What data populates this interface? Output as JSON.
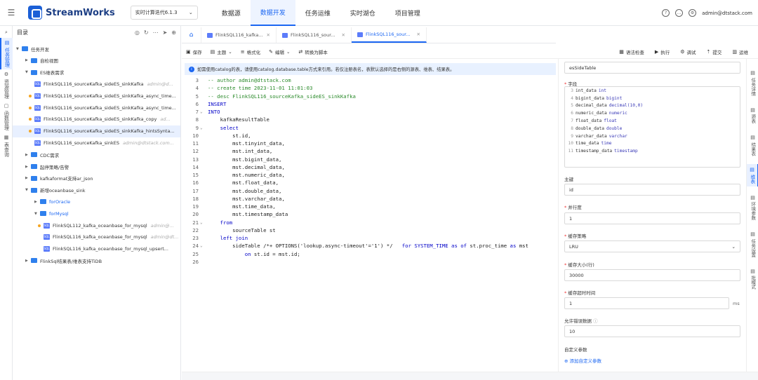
{
  "header": {
    "app_name": "StreamWorks",
    "version_select": "实时计算迭代6.1.3",
    "nav": [
      {
        "label": "数据源",
        "active": false
      },
      {
        "label": "数据开发",
        "active": true
      },
      {
        "label": "任务运维",
        "active": false
      },
      {
        "label": "实时湖仓",
        "active": false
      },
      {
        "label": "项目管理",
        "active": false
      }
    ],
    "user": "admin@dtstack.com"
  },
  "left_rail": [
    {
      "label": "任务管理",
      "active": true
    },
    {
      "label": "资源管理",
      "active": false
    },
    {
      "label": "函数管理",
      "active": false
    },
    {
      "label": "表查询",
      "active": false
    }
  ],
  "tree": {
    "title": "目录",
    "rows": [
      {
        "label": "任务开发",
        "type": "folder",
        "level": 0,
        "expanded": true
      },
      {
        "label": "自检视图",
        "type": "folder",
        "level": 1,
        "expanded": false
      },
      {
        "label": "ES维表需求",
        "type": "folder",
        "level": 1,
        "expanded": true
      },
      {
        "label": "FlinkSQL116_sourceKafka_sideES_sinkKafka",
        "type": "sql",
        "level": 2,
        "owner": "admin@d...",
        "dot": false
      },
      {
        "label": "FlinkSQL116_sourceKafka_sideES_sinkKafka_async_time...",
        "type": "sql",
        "level": 2,
        "owner": "",
        "dot": true
      },
      {
        "label": "FlinkSQL116_sourceKafka_sideES_sinkKafka_async_time...",
        "type": "sql",
        "level": 2,
        "owner": "",
        "dot": true
      },
      {
        "label": "FlinkSQL116_sourceKafka_sideES_sinkKafka_copy",
        "type": "sql",
        "level": 2,
        "owner": "ad...",
        "dot": true
      },
      {
        "label": "FlinkSQL116_sourceKafka_sideES_sinkKafka_hintsSynta...",
        "type": "sql",
        "level": 2,
        "owner": "",
        "dot": true,
        "selected": true
      },
      {
        "label": "FlinkSQL116_sourceKafka_sinkES",
        "type": "sql",
        "level": 2,
        "owner": "admin@dtstack.com...",
        "dot": false
      },
      {
        "label": "CDC需求",
        "type": "folder",
        "level": 1,
        "expanded": false
      },
      {
        "label": "起停策略/告警",
        "type": "folder",
        "level": 1,
        "expanded": false
      },
      {
        "label": "kafkaformat支持ar_json",
        "type": "folder",
        "level": 1,
        "expanded": false
      },
      {
        "label": "新增oceanbase_sink",
        "type": "folder",
        "level": 1,
        "expanded": true
      },
      {
        "label": "forOracle",
        "type": "folder",
        "level": 2,
        "expanded": false
      },
      {
        "label": "forMysql",
        "type": "folder",
        "level": 2,
        "expanded": true
      },
      {
        "label": "FlinkSQL112_kafka_oceanbase_for_mysql",
        "type": "sql",
        "level": 3,
        "owner": "admin@...",
        "dot": true
      },
      {
        "label": "FlinkSQL116_kafka_oceanbase_for_mysql",
        "type": "sql",
        "level": 3,
        "owner": "admin@dt...",
        "dot": false
      },
      {
        "label": "FlinkSQL116_kafka_oceanbase_for_mysql_upsert...",
        "type": "sql",
        "level": 3,
        "owner": "",
        "dot": false
      },
      {
        "label": "FlinkSql结果表/维表支持TiDB",
        "type": "folder",
        "level": 1,
        "expanded": false
      }
    ]
  },
  "tabs": [
    {
      "label": "FlinkSQL116_kafka...",
      "active": false
    },
    {
      "label": "FlinkSQL116_sour...",
      "active": false
    },
    {
      "label": "FlinkSQL116_sour...",
      "active": true
    }
  ],
  "toolbar": {
    "left": [
      "保存",
      "主题",
      "格式化",
      "编辑",
      "转换为脚本"
    ],
    "right": [
      "语法检查",
      "执行",
      "调试",
      "提交",
      "运维"
    ]
  },
  "banner": "如需使用catalog的表，请使用catalog.database.table方式来引用。若仅注册表名，表默认选择的是右侧的源表、维表、结果表。",
  "code_lines": [
    {
      "n": "3",
      "fold": "",
      "segs": [
        {
          "t": "-- author admin@dtstack.com",
          "c": "cm"
        }
      ]
    },
    {
      "n": "4",
      "fold": "",
      "segs": [
        {
          "t": "-- create time 2023-11-01 11:01:03",
          "c": "cm"
        }
      ]
    },
    {
      "n": "5",
      "fold": "",
      "segs": [
        {
          "t": "-- desc FlinkSQL116_sourceKafka_sideES_sinkKafka",
          "c": "cm"
        }
      ]
    },
    {
      "n": "6",
      "fold": "",
      "segs": [
        {
          "t": "INSERT",
          "c": "kw"
        }
      ]
    },
    {
      "n": "7",
      "fold": "v",
      "segs": [
        {
          "t": "INTO",
          "c": "kw"
        }
      ]
    },
    {
      "n": "8",
      "fold": "",
      "segs": [
        {
          "t": "    kafkaResultTable",
          "c": "tx"
        }
      ]
    },
    {
      "n": "9",
      "fold": "v",
      "segs": [
        {
          "t": "    select",
          "c": "kw"
        }
      ]
    },
    {
      "n": "10",
      "fold": "",
      "segs": [
        {
          "t": "        st.id,",
          "c": "tx"
        }
      ]
    },
    {
      "n": "11",
      "fold": "",
      "segs": [
        {
          "t": "        mst.tinyint_data,",
          "c": "tx"
        }
      ]
    },
    {
      "n": "12",
      "fold": "",
      "segs": [
        {
          "t": "        mst.int_data,",
          "c": "tx"
        }
      ]
    },
    {
      "n": "13",
      "fold": "",
      "segs": [
        {
          "t": "        mst.bigint_data,",
          "c": "tx"
        }
      ]
    },
    {
      "n": "14",
      "fold": "",
      "segs": [
        {
          "t": "        mst.decimal_data,",
          "c": "tx"
        }
      ]
    },
    {
      "n": "15",
      "fold": "",
      "segs": [
        {
          "t": "        mst.numeric_data,",
          "c": "tx"
        }
      ]
    },
    {
      "n": "16",
      "fold": "",
      "segs": [
        {
          "t": "        mst.float_data,",
          "c": "tx"
        }
      ]
    },
    {
      "n": "17",
      "fold": "",
      "segs": [
        {
          "t": "        mst.double_data,",
          "c": "tx"
        }
      ]
    },
    {
      "n": "18",
      "fold": "",
      "segs": [
        {
          "t": "        mst.varchar_data,",
          "c": "tx"
        }
      ]
    },
    {
      "n": "19",
      "fold": "",
      "segs": [
        {
          "t": "        mst.time_data,",
          "c": "tx"
        }
      ]
    },
    {
      "n": "20",
      "fold": "",
      "segs": [
        {
          "t": "        mst.timestamp_data",
          "c": "tx"
        }
      ]
    },
    {
      "n": "21",
      "fold": "v",
      "segs": [
        {
          "t": "    from",
          "c": "kw"
        }
      ]
    },
    {
      "n": "22",
      "fold": "",
      "segs": [
        {
          "t": "        sourceTable st",
          "c": "tx"
        }
      ]
    },
    {
      "n": "23",
      "fold": "",
      "segs": [
        {
          "t": "    left join",
          "c": "kw"
        }
      ]
    },
    {
      "n": "24",
      "fold": "v",
      "segs": [
        {
          "t": "        sideTable /*+ OPTIONS('lookup.async-timeout'='1') */   ",
          "c": "tx"
        },
        {
          "t": "for SYSTEM_TIME as of ",
          "c": "kw"
        },
        {
          "t": "st.proc_time ",
          "c": "tx"
        },
        {
          "t": "as ",
          "c": "kw"
        },
        {
          "t": "mst",
          "c": "tx"
        }
      ]
    },
    {
      "n": "25",
      "fold": "",
      "segs": [
        {
          "t": "            ",
          "c": "tx"
        },
        {
          "t": "on ",
          "c": "kw"
        },
        {
          "t": "st.id = mst.id;",
          "c": "tx"
        }
      ]
    },
    {
      "n": "26",
      "fold": "",
      "segs": [
        {
          "t": "",
          "c": "tx"
        }
      ]
    }
  ],
  "right_panel": {
    "table_name": "esSideTable",
    "fields_label": "字段",
    "fields": [
      {
        "name": "int_data",
        "type": "int"
      },
      {
        "name": "bigint_data",
        "type": "bigint"
      },
      {
        "name": "decimal_data",
        "type": "decimal(10,0)"
      },
      {
        "name": "numeric_data",
        "type": "numeric"
      },
      {
        "name": "float_data",
        "type": "float"
      },
      {
        "name": "double_data",
        "type": "double"
      },
      {
        "name": "varchar_data",
        "type": "varchar"
      },
      {
        "name": "time_data",
        "type": "time"
      },
      {
        "name": "timestamp_data",
        "type": "timestamp"
      }
    ],
    "primary_key_label": "主键",
    "primary_key": "id",
    "parallelism_label": "并行度",
    "parallelism": "1",
    "cache_strategy_label": "缓存策略",
    "cache_strategy": "LRU",
    "cache_size_label": "缓存大小(行)",
    "cache_size": "30000",
    "cache_timeout_label": "缓存超时时间",
    "cache_timeout": "1",
    "cache_timeout_unit": "ms",
    "allow_errors_label": "允许错误数据",
    "allow_errors": "10",
    "custom_params_label": "自定义参数",
    "add_param": "添加自定义参数"
  },
  "right_rail": [
    {
      "label": "任务详情",
      "active": false
    },
    {
      "label": "源表",
      "active": false
    },
    {
      "label": "结果表",
      "active": false
    },
    {
      "label": "维表",
      "active": true
    },
    {
      "label": "环境参数",
      "active": false
    },
    {
      "label": "任务设置",
      "active": false
    },
    {
      "label": "批模式",
      "active": false
    }
  ]
}
